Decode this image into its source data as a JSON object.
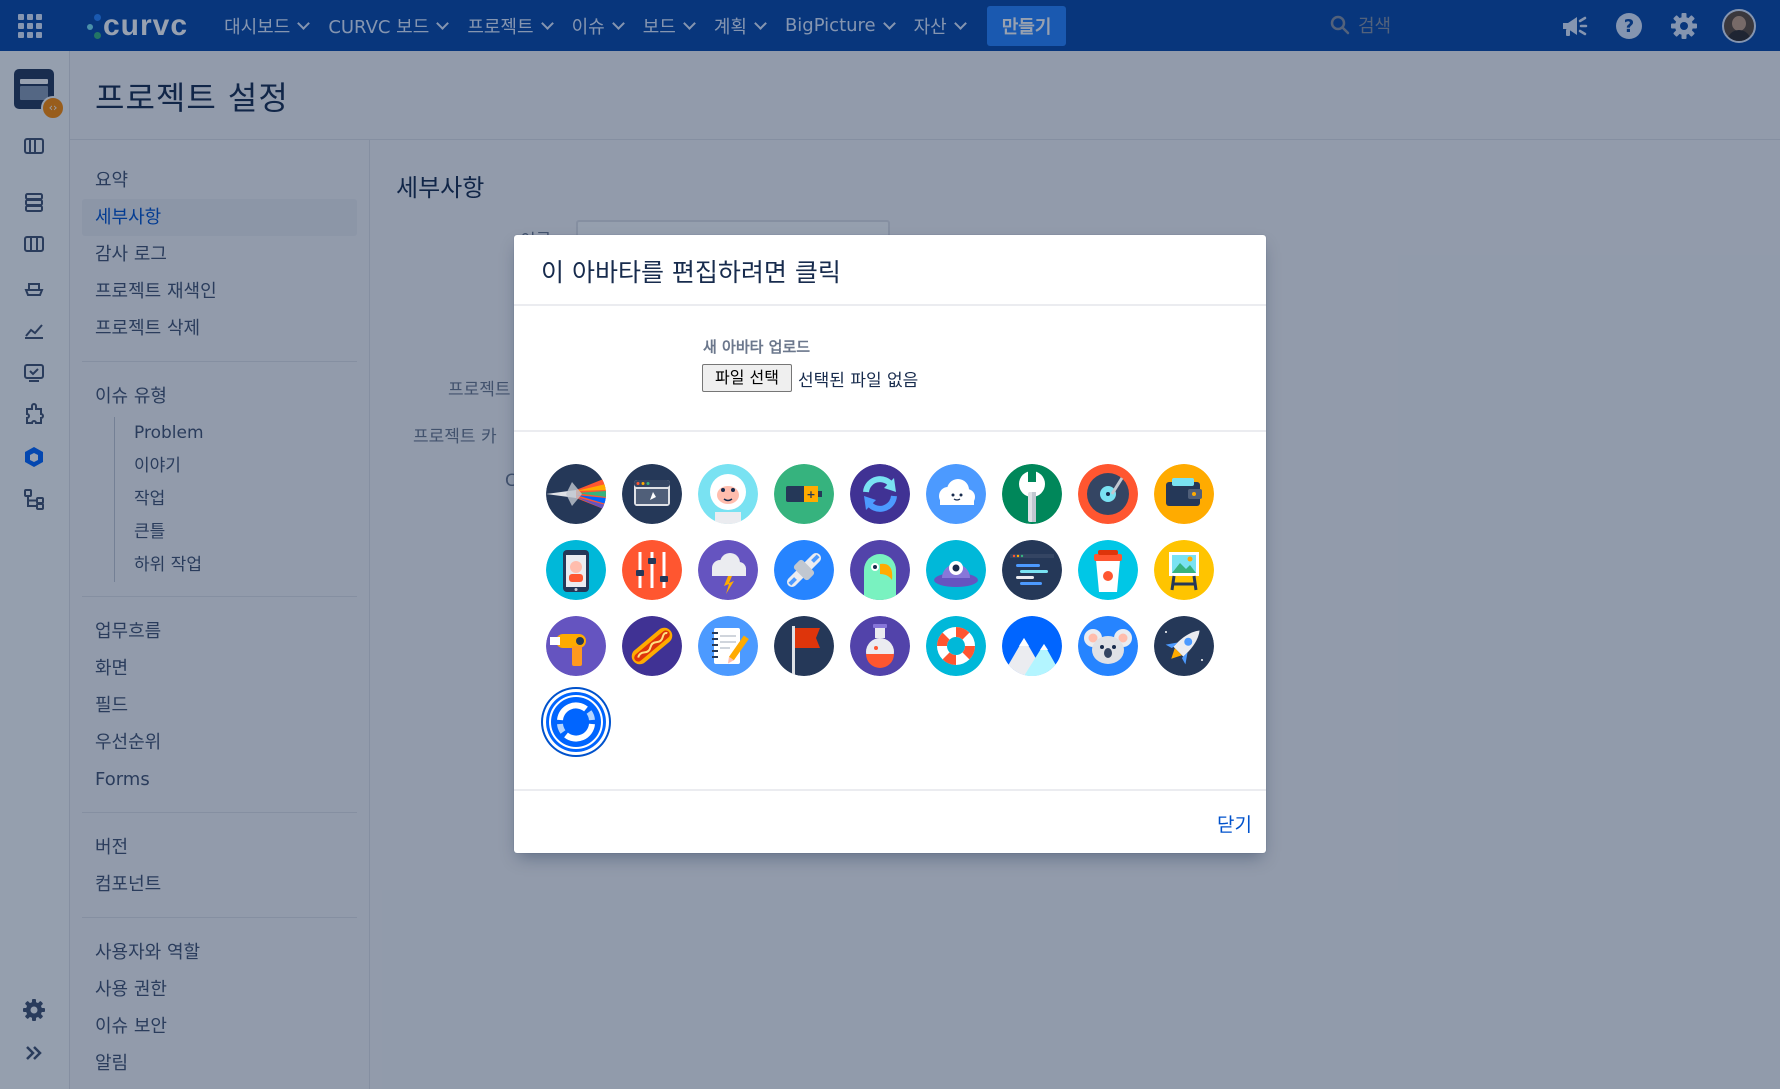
{
  "topnav": {
    "logo_text": "curvc",
    "items": [
      "대시보드",
      "CURVC 보드",
      "프로젝트",
      "이슈",
      "보드",
      "계획",
      "BigPicture",
      "자산"
    ],
    "create_label": "만들기",
    "search_placeholder": "검색"
  },
  "page": {
    "title": "프로젝트 설정",
    "section_title": "세부사항",
    "field_labels": [
      "이름",
      "프로젝트",
      "프로젝트 카",
      "C"
    ]
  },
  "settings_nav": {
    "group1": [
      "요약",
      "세부사항",
      "감사 로그",
      "프로젝트 재색인",
      "프로젝트 삭제"
    ],
    "issue_types_label": "이슈 유형",
    "issue_types": [
      "Problem",
      "이야기",
      "작업",
      "큰틀",
      "하위 작업"
    ],
    "group3": [
      "업무흐름",
      "화면",
      "필드",
      "우선순위",
      "Forms"
    ],
    "group4": [
      "버전",
      "컴포넌트"
    ],
    "group5": [
      "사용자와 역할",
      "사용 권한",
      "이슈 보안",
      "알림"
    ]
  },
  "dialog": {
    "title": "이 아바타를 편집하려면 클릭",
    "upload_label": "새 아바타 업로드",
    "file_button": "파일 선택",
    "file_status": "선택된 파일 없음",
    "close_label": "닫기",
    "avatars": [
      "prism",
      "browser-window",
      "monkey",
      "battery",
      "refresh",
      "cloud",
      "wrench",
      "vinyl-record",
      "wallet",
      "phone-selfie",
      "mixer-sliders",
      "storm-cloud",
      "satellite",
      "parrot",
      "alien-ufo",
      "code-terminal",
      "coffee-cup",
      "picture-easel",
      "hairdryer",
      "hotdog",
      "notebook-pencil",
      "red-flag",
      "potion",
      "lifebuoy",
      "mountains",
      "koala",
      "rocket",
      "circular-arrows"
    ],
    "selected_avatar": "circular-arrows"
  },
  "colors": {
    "nav_bg": "#0747a6",
    "accent": "#0052cc",
    "create_button": "#2684ff"
  }
}
